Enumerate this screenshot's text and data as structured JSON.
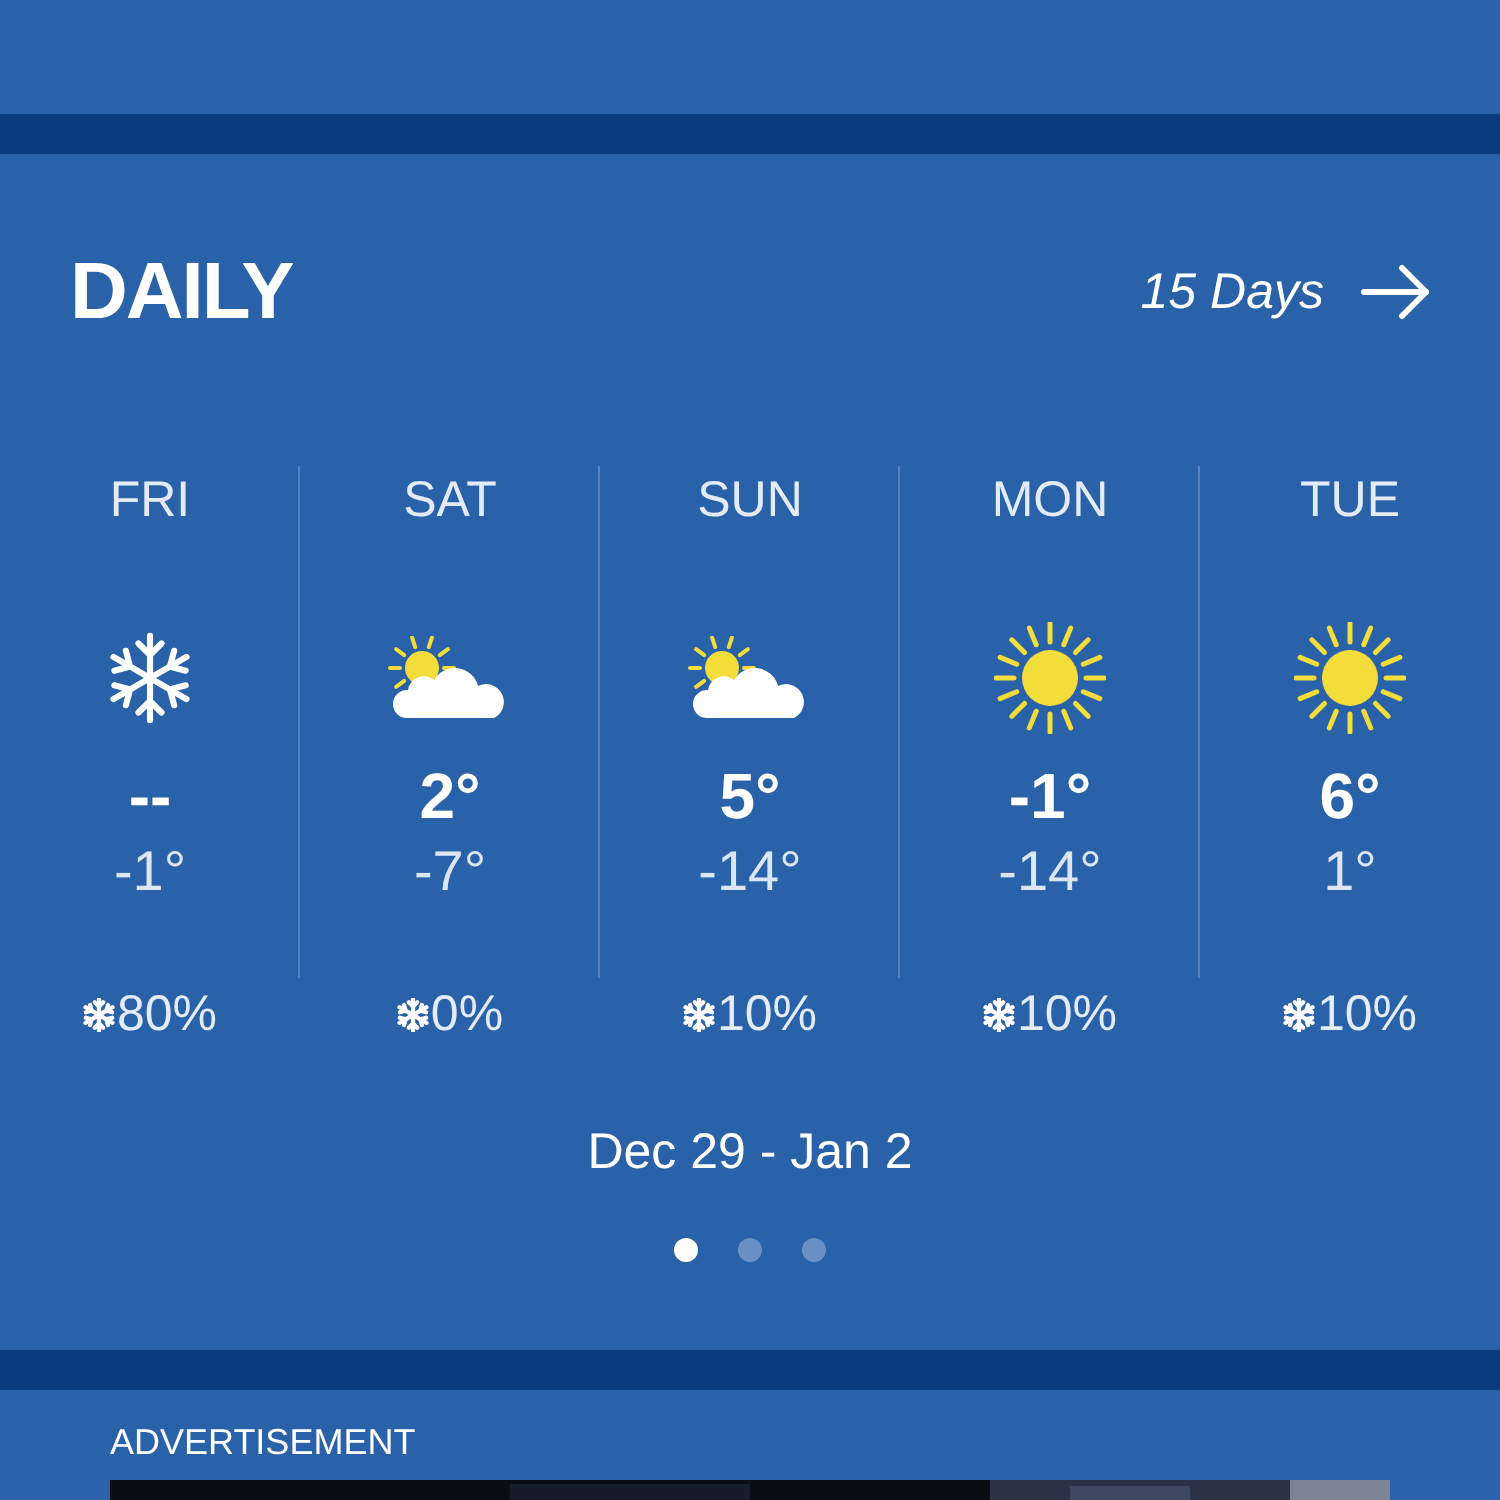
{
  "daily": {
    "title": "DAILY",
    "more_link": "15 Days",
    "days": [
      {
        "day": "FRI",
        "kind": "snow",
        "high": "--",
        "low": "-1°",
        "precip": "80%"
      },
      {
        "day": "SAT",
        "kind": "partly-cloudy",
        "high": "2°",
        "low": "-7°",
        "precip": "0%"
      },
      {
        "day": "SUN",
        "kind": "partly-cloudy",
        "high": "5°",
        "low": "-14°",
        "precip": "10%"
      },
      {
        "day": "MON",
        "kind": "sunny",
        "high": "-1°",
        "low": "-14°",
        "precip": "10%"
      },
      {
        "day": "TUE",
        "kind": "sunny",
        "high": "6°",
        "low": "1°",
        "precip": "10%"
      }
    ],
    "date_range": "Dec 29 - Jan 2",
    "pages": [
      {
        "selected": true
      },
      {
        "selected": false
      },
      {
        "selected": false
      }
    ]
  },
  "advertisement": {
    "label": "ADVERTISEMENT"
  }
}
